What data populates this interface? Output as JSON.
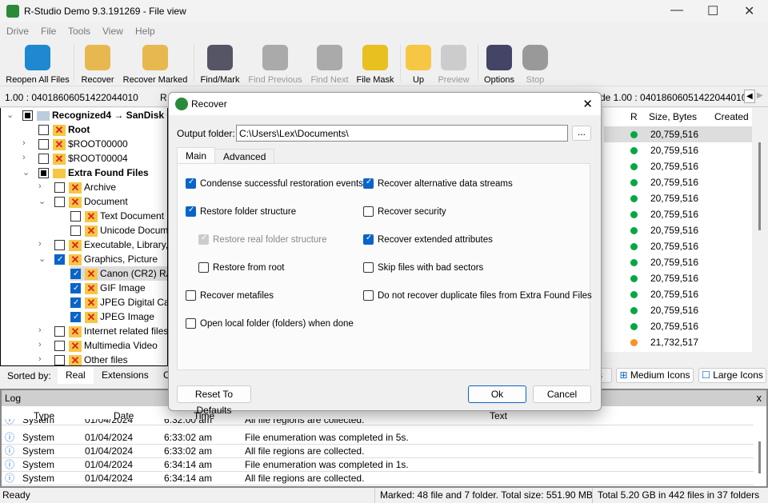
{
  "window": {
    "title": "R-Studio Demo 9.3.191269 - File view"
  },
  "menu": [
    "Drive",
    "File",
    "Tools",
    "View",
    "Help"
  ],
  "toolbar": [
    {
      "label": "Reopen All Files",
      "icon": "reopen-icon",
      "enabled": true
    },
    {
      "label": "Recover",
      "icon": "recover-icon",
      "enabled": true
    },
    {
      "label": "Recover Marked",
      "icon": "recover-marked-icon",
      "enabled": true
    },
    {
      "label": "Find/Mark",
      "icon": "binoculars-icon",
      "enabled": true
    },
    {
      "label": "Find Previous",
      "icon": "find-previous-icon",
      "enabled": false
    },
    {
      "label": "Find Next",
      "icon": "find-next-icon",
      "enabled": false
    },
    {
      "label": "File Mask",
      "icon": "file-mask-icon",
      "enabled": true
    },
    {
      "label": "Up",
      "icon": "up-folder-icon",
      "enabled": true
    },
    {
      "label": "Preview",
      "icon": "preview-icon",
      "enabled": false
    },
    {
      "label": "Options",
      "icon": "options-icon",
      "enabled": true
    },
    {
      "label": "Stop",
      "icon": "stop-icon",
      "enabled": false
    }
  ],
  "address": {
    "left": "1.00 : 04018606051422044010",
    "tab": "R",
    "right": "de 1.00 : 04018606051422044010"
  },
  "tree": [
    {
      "label": "Recognized4 → SanDisk Cr",
      "bold": true,
      "check": "part"
    },
    {
      "label": "Root",
      "bold": true,
      "check": "off"
    },
    {
      "label": "$ROOT00000",
      "check": "off"
    },
    {
      "label": "$ROOT00004",
      "check": "off"
    },
    {
      "label": "Extra Found Files",
      "bold": true,
      "check": "part"
    },
    {
      "label": "Archive",
      "check": "off"
    },
    {
      "label": "Document",
      "check": "off"
    },
    {
      "label": "Text Document",
      "check": "off"
    },
    {
      "label": "Unicode Docum",
      "check": "off"
    },
    {
      "label": "Executable, Library,",
      "check": "off"
    },
    {
      "label": "Graphics, Picture",
      "check": "on"
    },
    {
      "label": "Canon (CR2) RA",
      "check": "on"
    },
    {
      "label": "GIF Image",
      "check": "on"
    },
    {
      "label": "JPEG Digital Can",
      "check": "on"
    },
    {
      "label": "JPEG Image",
      "check": "on"
    },
    {
      "label": "Internet related files",
      "check": "off"
    },
    {
      "label": "Multimedia Video",
      "check": "off"
    },
    {
      "label": "Other files",
      "check": "off"
    }
  ],
  "list": {
    "headers": [
      "R",
      "Size, Bytes",
      "Created"
    ],
    "rows": [
      {
        "size": "20,759,516",
        "status": "green"
      },
      {
        "size": "20,759,516",
        "status": "green"
      },
      {
        "size": "20,759,516",
        "status": "green"
      },
      {
        "size": "20,759,516",
        "status": "green"
      },
      {
        "size": "20,759,516",
        "status": "green"
      },
      {
        "size": "20,759,516",
        "status": "green"
      },
      {
        "size": "20,759,516",
        "status": "green"
      },
      {
        "size": "20,759,516",
        "status": "green"
      },
      {
        "size": "20,759,516",
        "status": "green"
      },
      {
        "size": "20,759,516",
        "status": "green"
      },
      {
        "size": "20,759,516",
        "status": "green"
      },
      {
        "size": "20,759,516",
        "status": "green"
      },
      {
        "size": "20,759,516",
        "status": "green"
      },
      {
        "size": "21,732,517",
        "status": "orange"
      }
    ]
  },
  "colors": {
    "green": "#00a846",
    "orange": "#f7931e",
    "accent": "#0a64c8"
  },
  "sortbar": {
    "label": "Sorted by:",
    "tabs": [
      "Real",
      "Extensions",
      "C"
    ],
    "views": [
      "s",
      "Medium Icons",
      "Large Icons"
    ]
  },
  "log": {
    "title": "Log",
    "close": "x",
    "headers": [
      "Type",
      "Date",
      "Time",
      "Text"
    ],
    "rows": [
      {
        "type": "System",
        "date": "01/04/2024",
        "time": "6:32:00 am",
        "text": "All file regions are collected."
      },
      {
        "type": "System",
        "date": "01/04/2024",
        "time": "6:33:02 am",
        "text": "File enumeration was completed in 5s."
      },
      {
        "type": "System",
        "date": "01/04/2024",
        "time": "6:33:02 am",
        "text": "All file regions are collected."
      },
      {
        "type": "System",
        "date": "01/04/2024",
        "time": "6:34:14 am",
        "text": "File enumeration was completed in 1s."
      },
      {
        "type": "System",
        "date": "01/04/2024",
        "time": "6:34:14 am",
        "text": "All file regions are collected."
      }
    ]
  },
  "status": {
    "ready": "Ready",
    "marked": "Marked: 48 file and 7 folder. Total size: 551.90 MB",
    "total": "Total 5.20 GB in 442 files in 37 folders"
  },
  "dialog": {
    "title": "Recover",
    "output_label": "Output folder:",
    "output_value": "C:\\Users\\Lex\\Documents\\",
    "browse": "...",
    "tabs": [
      "Main",
      "Advanced"
    ],
    "options": [
      {
        "label": "Condense successful restoration events",
        "checked": true,
        "enabled": true
      },
      {
        "label": "Recover alternative data streams",
        "checked": true,
        "enabled": true
      },
      {
        "label": "Restore folder structure",
        "checked": true,
        "enabled": true
      },
      {
        "label": "Recover security",
        "checked": false,
        "enabled": true
      },
      {
        "label": "Restore real folder structure",
        "checked": true,
        "enabled": false
      },
      {
        "label": "Recover extended attributes",
        "checked": true,
        "enabled": true
      },
      {
        "label": "Restore from root",
        "checked": false,
        "enabled": true
      },
      {
        "label": "Skip files with bad sectors",
        "checked": false,
        "enabled": true
      },
      {
        "label": "Recover metafiles",
        "checked": false,
        "enabled": true
      },
      {
        "label": "Do not recover duplicate files from Extra Found Files",
        "checked": false,
        "enabled": true
      },
      {
        "label": "Open local folder (folders) when done",
        "checked": false,
        "enabled": true
      }
    ],
    "reset": "Reset To Defaults",
    "ok": "Ok",
    "cancel": "Cancel",
    "close": "✕"
  }
}
